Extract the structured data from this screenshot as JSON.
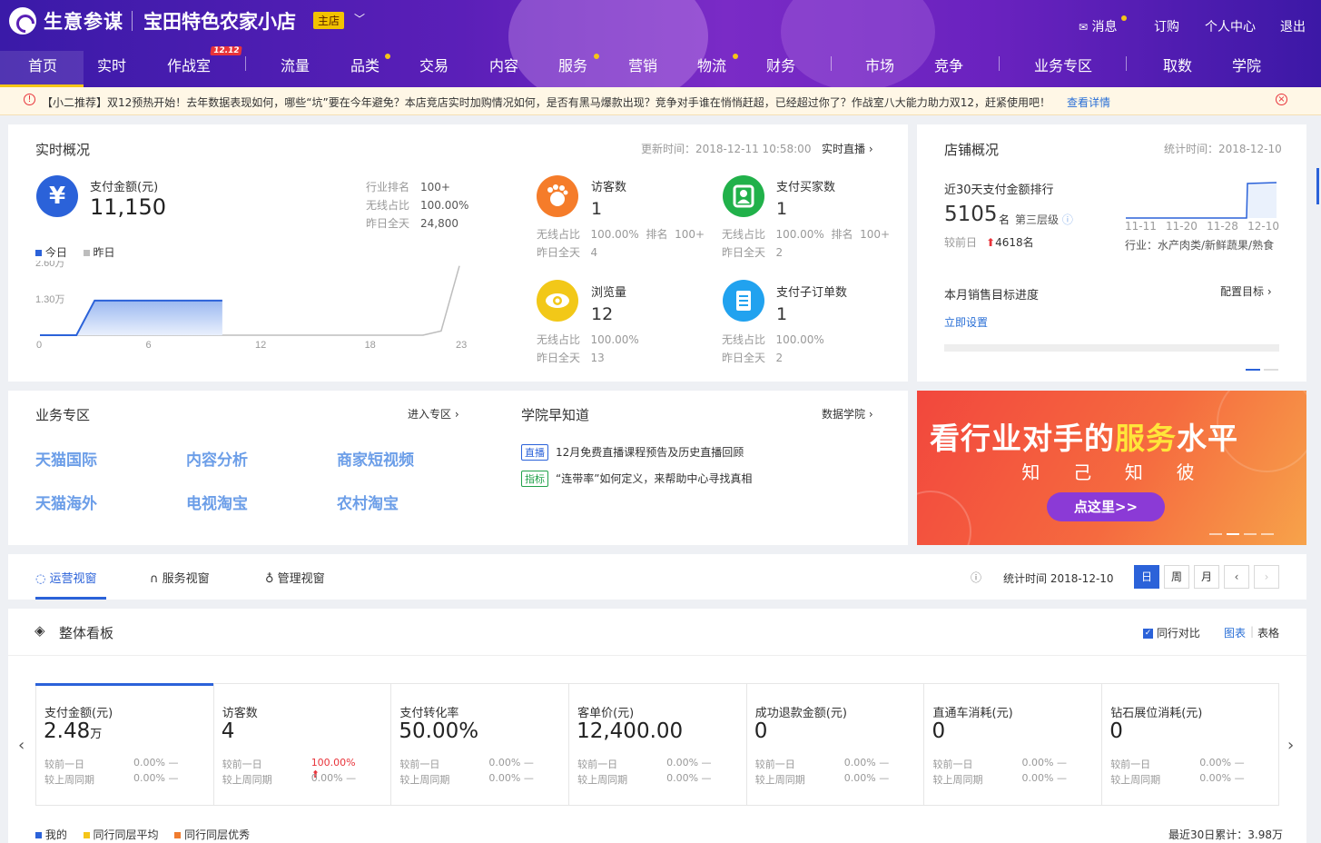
{
  "header": {
    "brand": "生意参谋",
    "shop_name": "宝田特色农家小店",
    "shop_tag": "主店",
    "top_links": [
      "消息",
      "订购",
      "个人中心",
      "退出"
    ],
    "nav": [
      "首页",
      "实时",
      "作战室",
      "流量",
      "品类",
      "交易",
      "内容",
      "服务",
      "营销",
      "物流",
      "财务",
      "市场",
      "竞争",
      "业务专区",
      "取数",
      "学院"
    ],
    "nav_badge": "12.12"
  },
  "notice": {
    "text": "【小二推荐】双12预热开始！去年数据表现如何，哪些“坑”要在今年避免？本店竞店实时加购情况如何，是否有黑马爆款出现？竞争对手谁在悄悄赶超，已经超过你了？作战室八大能力助力双12，赶紧使用吧！",
    "link": "查看详情"
  },
  "realtime": {
    "title": "实时概况",
    "update_time": "更新时间：2018-12-11 10:58:00",
    "live_link": "实时直播",
    "pay_amount_label": "支付金额(元)",
    "pay_amount": "11,150",
    "side_rows": [
      [
        "行业排名",
        "100+"
      ],
      [
        "无线占比",
        "100.00%"
      ],
      [
        "昨日全天",
        "24,800"
      ]
    ],
    "legend_today": "今日",
    "legend_yesterday": "昨日",
    "y_ticks": [
      "2.60万",
      "1.30万"
    ],
    "x_ticks": [
      "0",
      "6",
      "12",
      "18",
      "23"
    ],
    "metrics": [
      {
        "label": "访客数",
        "value": "1",
        "row1": "无线占比   100.00%  排名  100+",
        "row2": "昨日全天   4"
      },
      {
        "label": "支付买家数",
        "value": "1",
        "row1": "无线占比   100.00%  排名  100+",
        "row2": "昨日全天   2"
      },
      {
        "label": "浏览量",
        "value": "12",
        "row1": "无线占比   100.00%",
        "row2": "昨日全天   13"
      },
      {
        "label": "支付子订单数",
        "value": "1",
        "row1": "无线占比   100.00%",
        "row2": "昨日全天   2"
      }
    ]
  },
  "chart_data": {
    "type": "area",
    "x": [
      0,
      1,
      2,
      3,
      4,
      5,
      6,
      7,
      8,
      9,
      10,
      11,
      12,
      13,
      14,
      15,
      16,
      17,
      18,
      19,
      20,
      21,
      22,
      23
    ],
    "series": [
      {
        "name": "今日",
        "values": [
          0,
          0,
          0,
          12400,
          12400,
          12400,
          12400,
          12400,
          12400,
          12400,
          12400,
          null,
          null,
          null,
          null,
          null,
          null,
          null,
          null,
          null,
          null,
          null,
          null,
          null
        ]
      },
      {
        "name": "昨日",
        "values": [
          0,
          0,
          0,
          0,
          0,
          0,
          0,
          0,
          0,
          0,
          0,
          0,
          0,
          0,
          0,
          0,
          0,
          0,
          0,
          0,
          0,
          0,
          1500,
          24800
        ]
      }
    ],
    "ylim": [
      0,
      26000
    ],
    "colors": {
      "today": "#2b62d9",
      "yesterday": "#bdbdbd"
    }
  },
  "shop": {
    "title": "店铺概况",
    "stat_time": "统计时间：2018-12-10",
    "rank_label": "近30天支付金额排行",
    "rank_value": "5105",
    "rank_unit": "名",
    "tier": "第三层级",
    "compare_label": "较前日",
    "compare_value": "4618名",
    "dates": [
      "11-11",
      "11-20",
      "11-28",
      "12-10"
    ],
    "industry": "行业：水产肉类/新鲜蔬果/熟食",
    "goal_label": "本月销售目标进度",
    "goal_config": "配置目标",
    "goal_set": "立即设置"
  },
  "business": {
    "title": "业务专区",
    "enter": "进入专区",
    "items": [
      "天猫国际",
      "内容分析",
      "商家短视频",
      "天猫海外",
      "电视淘宝",
      "农村淘宝"
    ]
  },
  "academy": {
    "title": "学院早知道",
    "link": "数据学院",
    "items": [
      {
        "tag": "直播",
        "text": "12月免费直播课程预告及历史直播回顾"
      },
      {
        "tag": "指标",
        "text": "“连带率”如何定义，来帮助中心寻找真相"
      }
    ]
  },
  "banner": {
    "headline_a": "看行业对手的",
    "headline_b": "服务",
    "headline_c": "水平",
    "sub": "知  己  知  彼",
    "cta": "点这里>>"
  },
  "tabs": {
    "items": [
      "运营视窗",
      "服务视窗",
      "管理视窗"
    ],
    "stat_time": "统计时间 2018-12-10",
    "period": [
      "日",
      "周",
      "月"
    ]
  },
  "board": {
    "title": "整体看板",
    "peer_compare": "同行对比",
    "view_chart": "图表",
    "view_table": "表格",
    "kpis": [
      {
        "name": "支付金额(元)",
        "value": "2.48",
        "unit": "万",
        "p1": "0.00%",
        "p2": "0.00%"
      },
      {
        "name": "访客数",
        "value": "4",
        "unit": "",
        "p1": "100.00%",
        "p2": "0.00%"
      },
      {
        "name": "支付转化率",
        "value": "50.00%",
        "unit": "",
        "p1": "0.00%",
        "p2": "0.00%"
      },
      {
        "name": "客单价(元)",
        "value": "12,400.00",
        "unit": "",
        "p1": "0.00%",
        "p2": "0.00%"
      },
      {
        "name": "成功退款金额(元)",
        "value": "0",
        "unit": "",
        "p1": "0.00%",
        "p2": "0.00%"
      },
      {
        "name": "直通车消耗(元)",
        "value": "0",
        "unit": "",
        "p1": "0.00%",
        "p2": "0.00%"
      },
      {
        "name": "钻石展位消耗(元)",
        "value": "0",
        "unit": "",
        "p1": "0.00%",
        "p2": "0.00%"
      }
    ],
    "row_labels": [
      "较前一日",
      "较上周同期"
    ],
    "legend": [
      "我的",
      "同行同层平均",
      "同行同层优秀"
    ],
    "legend_colors": [
      "#2b62d9",
      "#f5c518",
      "#f07c2f"
    ],
    "total": "最近30日累计：3.98万"
  }
}
